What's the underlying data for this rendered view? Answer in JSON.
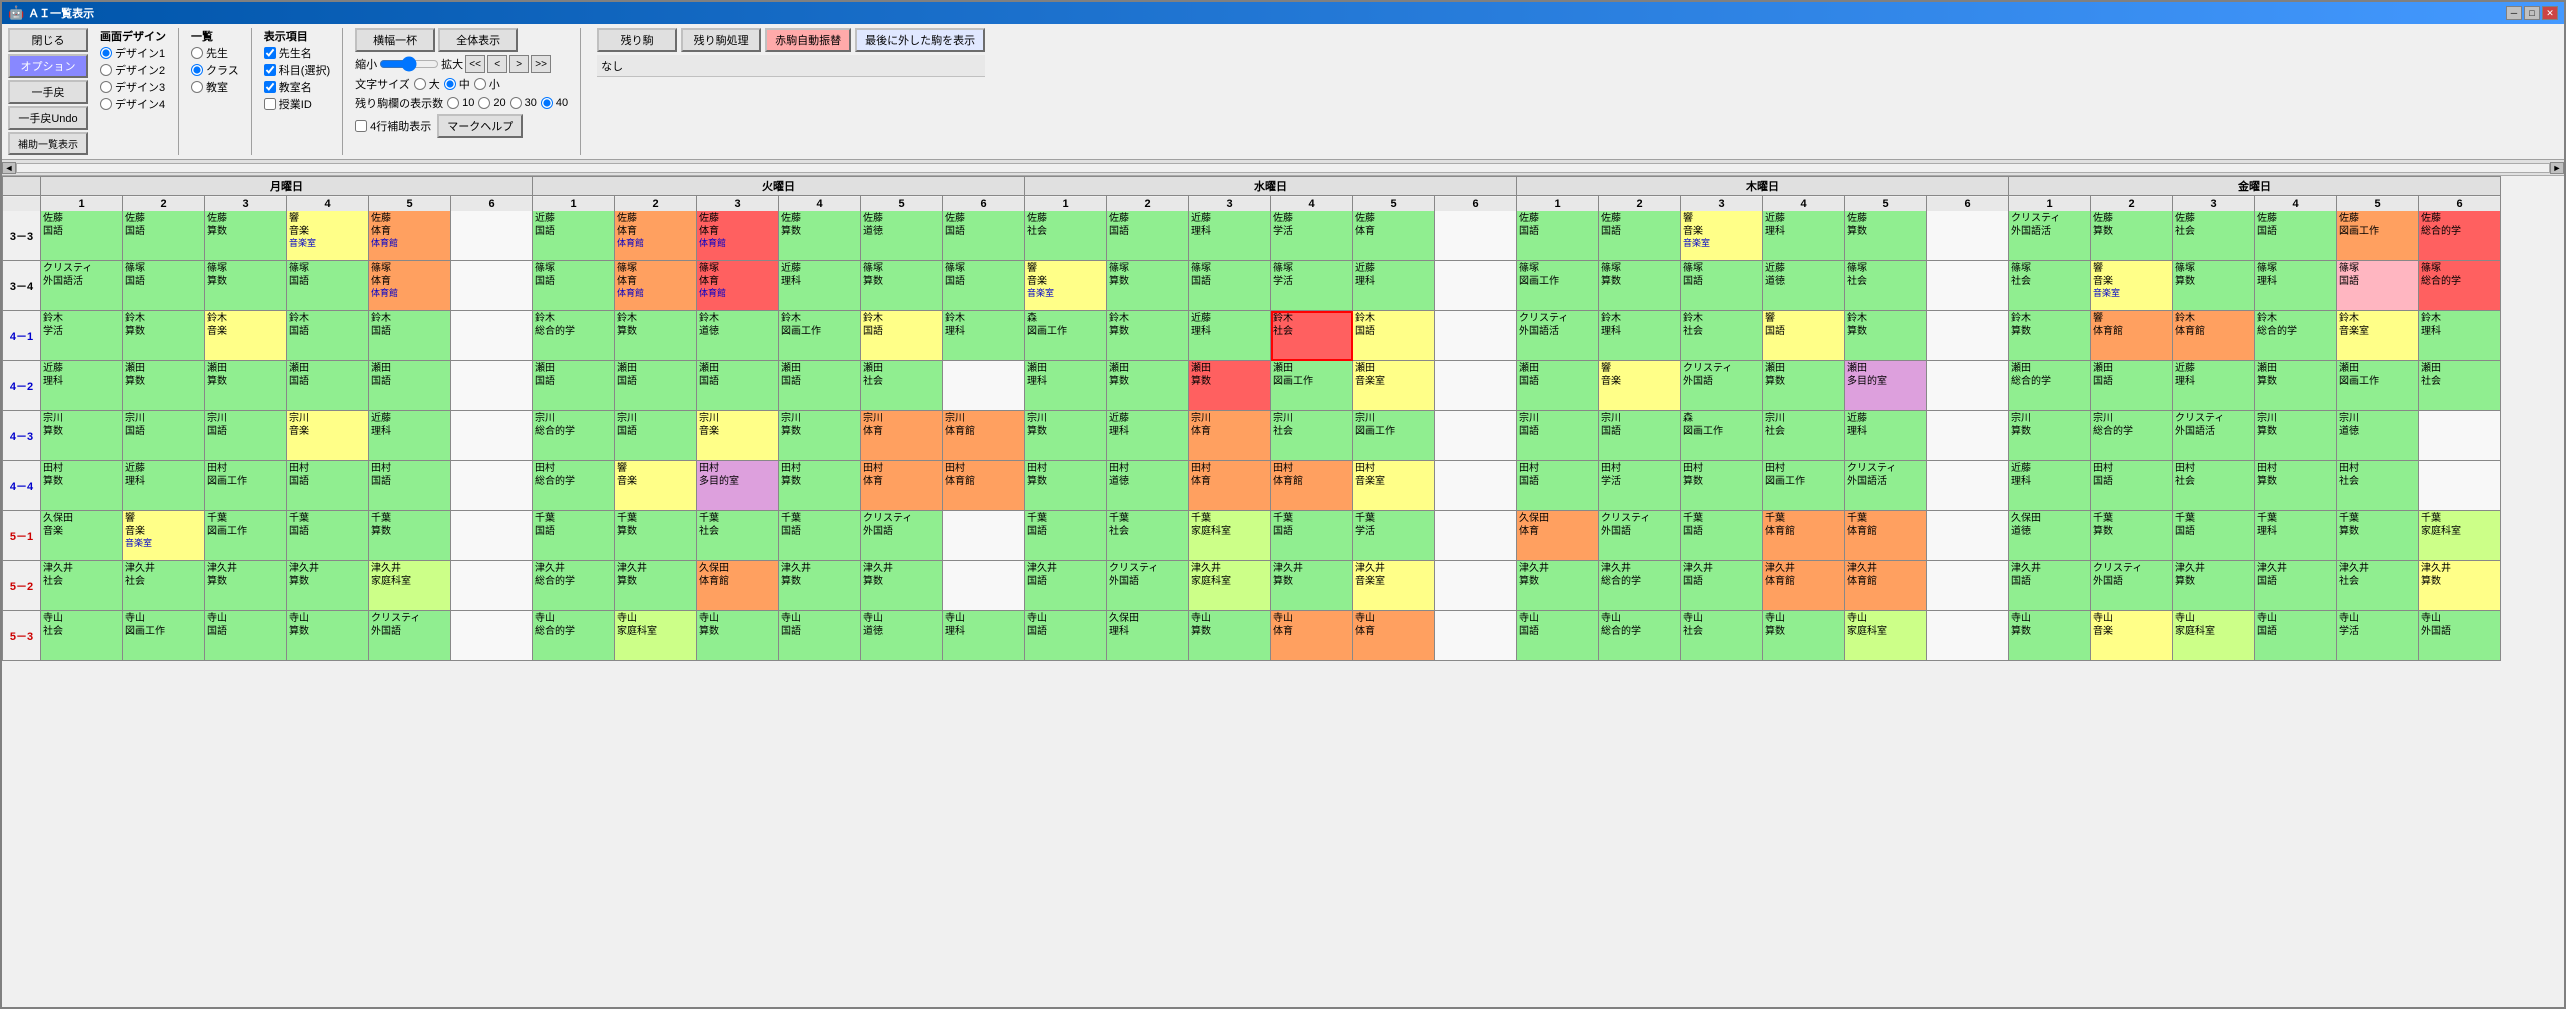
{
  "window": {
    "title": "ＡＩ一覧表示",
    "icon": "ai-icon"
  },
  "titlebar_buttons": [
    "minimize",
    "restore",
    "close"
  ],
  "toolbar": {
    "close_label": "閉じる",
    "options_label": "オプション",
    "one_back_label": "一手戻",
    "one_back_undo_label": "一手戻Undo",
    "aux_list_label": "補助一覧表示",
    "screen_design_label": "画面デザイン",
    "design1": "デザイン1",
    "design2": "デザイン2",
    "design3": "デザイン3",
    "design4": "デザイン4",
    "ichiran_label": "一覧",
    "radio_teacher": "先生",
    "radio_class": "クラス",
    "radio_classroom": "教室",
    "display_items_label": "表示項目",
    "check_teacher_name": "先生名",
    "check_subject": "科目(選択)",
    "check_classroom": "教室名",
    "check_lesson_id": "授業ID",
    "fit_width_label": "横幅一杯",
    "show_all_label": "全体表示",
    "zoom_small": "縮小",
    "zoom_large": "拡大",
    "nav_prev_prev": "<<",
    "nav_prev": "<",
    "nav_next": ">",
    "nav_next_next": ">>",
    "font_size_label": "文字サイズ",
    "font_large": "大",
    "font_medium": "中",
    "font_small": "小",
    "remaining_cols_label": "残り駒欄の表示数",
    "r10": "10",
    "r20": "20",
    "r30": "30",
    "r40": "40",
    "four_row_label": "4行補助表示",
    "mark_help_label": "マークヘルプ",
    "remaining_label": "残り駒",
    "remaining_process_label": "残り駒処理",
    "red_horse_label": "赤駒自動振替",
    "last_removed_label": "最後に外した駒を表示",
    "status_text": "なし"
  },
  "days": [
    "月曜日",
    "火曜日",
    "水曜日",
    "木曜日",
    "金曜日"
  ],
  "periods": [
    "1",
    "2",
    "3",
    "4",
    "5",
    "6"
  ],
  "classes": [
    "3-3",
    "3-4",
    "4-1",
    "4-2",
    "4-3",
    "4-4",
    "5-1",
    "5-2",
    "5-3"
  ],
  "cells": {}
}
